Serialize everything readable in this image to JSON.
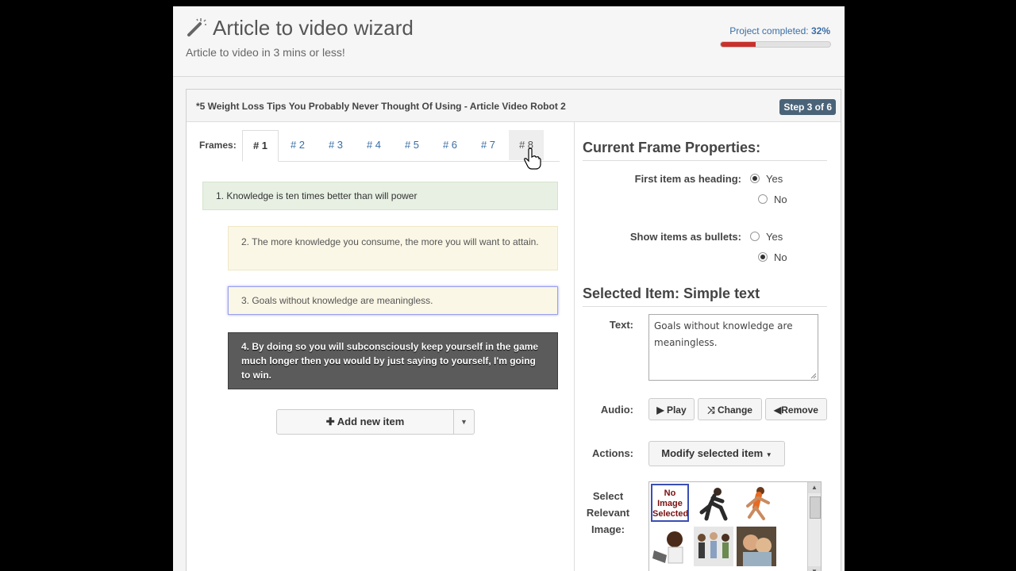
{
  "header": {
    "title": "Article to video wizard",
    "subtitle": "Article to video in 3 mins or less!",
    "progress_label": "Project completed:",
    "progress_value": "32%",
    "progress_fraction": 0.32
  },
  "panel": {
    "title": "*5 Weight Loss Tips You Probably Never Thought Of Using - Article Video Robot 2",
    "step": "Step 3 of 6"
  },
  "frames": {
    "label": "Frames:",
    "tabs": [
      "# 1",
      "# 2",
      "# 3",
      "# 4",
      "# 5",
      "# 6",
      "# 7",
      "# 8"
    ]
  },
  "items": [
    "1. Knowledge is ten times better than will power",
    "2. The more knowledge you consume, the more you will want to attain.",
    "3. Goals without knowledge are meaningless.",
    "4. By doing so you will subconsciously keep yourself in the game much longer then you would by just saying to yourself, I'm going to win."
  ],
  "add_item_label": "Add new item",
  "properties": {
    "title": "Current Frame Properties:",
    "heading_label": "First item as heading:",
    "bullets_label": "Show items as bullets:",
    "yes": "Yes",
    "no": "No"
  },
  "selected": {
    "title": "Selected Item: Simple text",
    "text_label": "Text:",
    "text_value": "Goals without knowledge are meaningless.",
    "audio_label": "Audio:",
    "play": "Play",
    "change": "Change",
    "remove": "Remove",
    "actions_label": "Actions:",
    "modify": "Modify selected item",
    "image_label": "Select Relevant Image:",
    "no_image": "No Image Selected"
  },
  "colors": {
    "accent": "#3a6ea5",
    "progress": "#c9302c",
    "badge": "#4a6378"
  }
}
